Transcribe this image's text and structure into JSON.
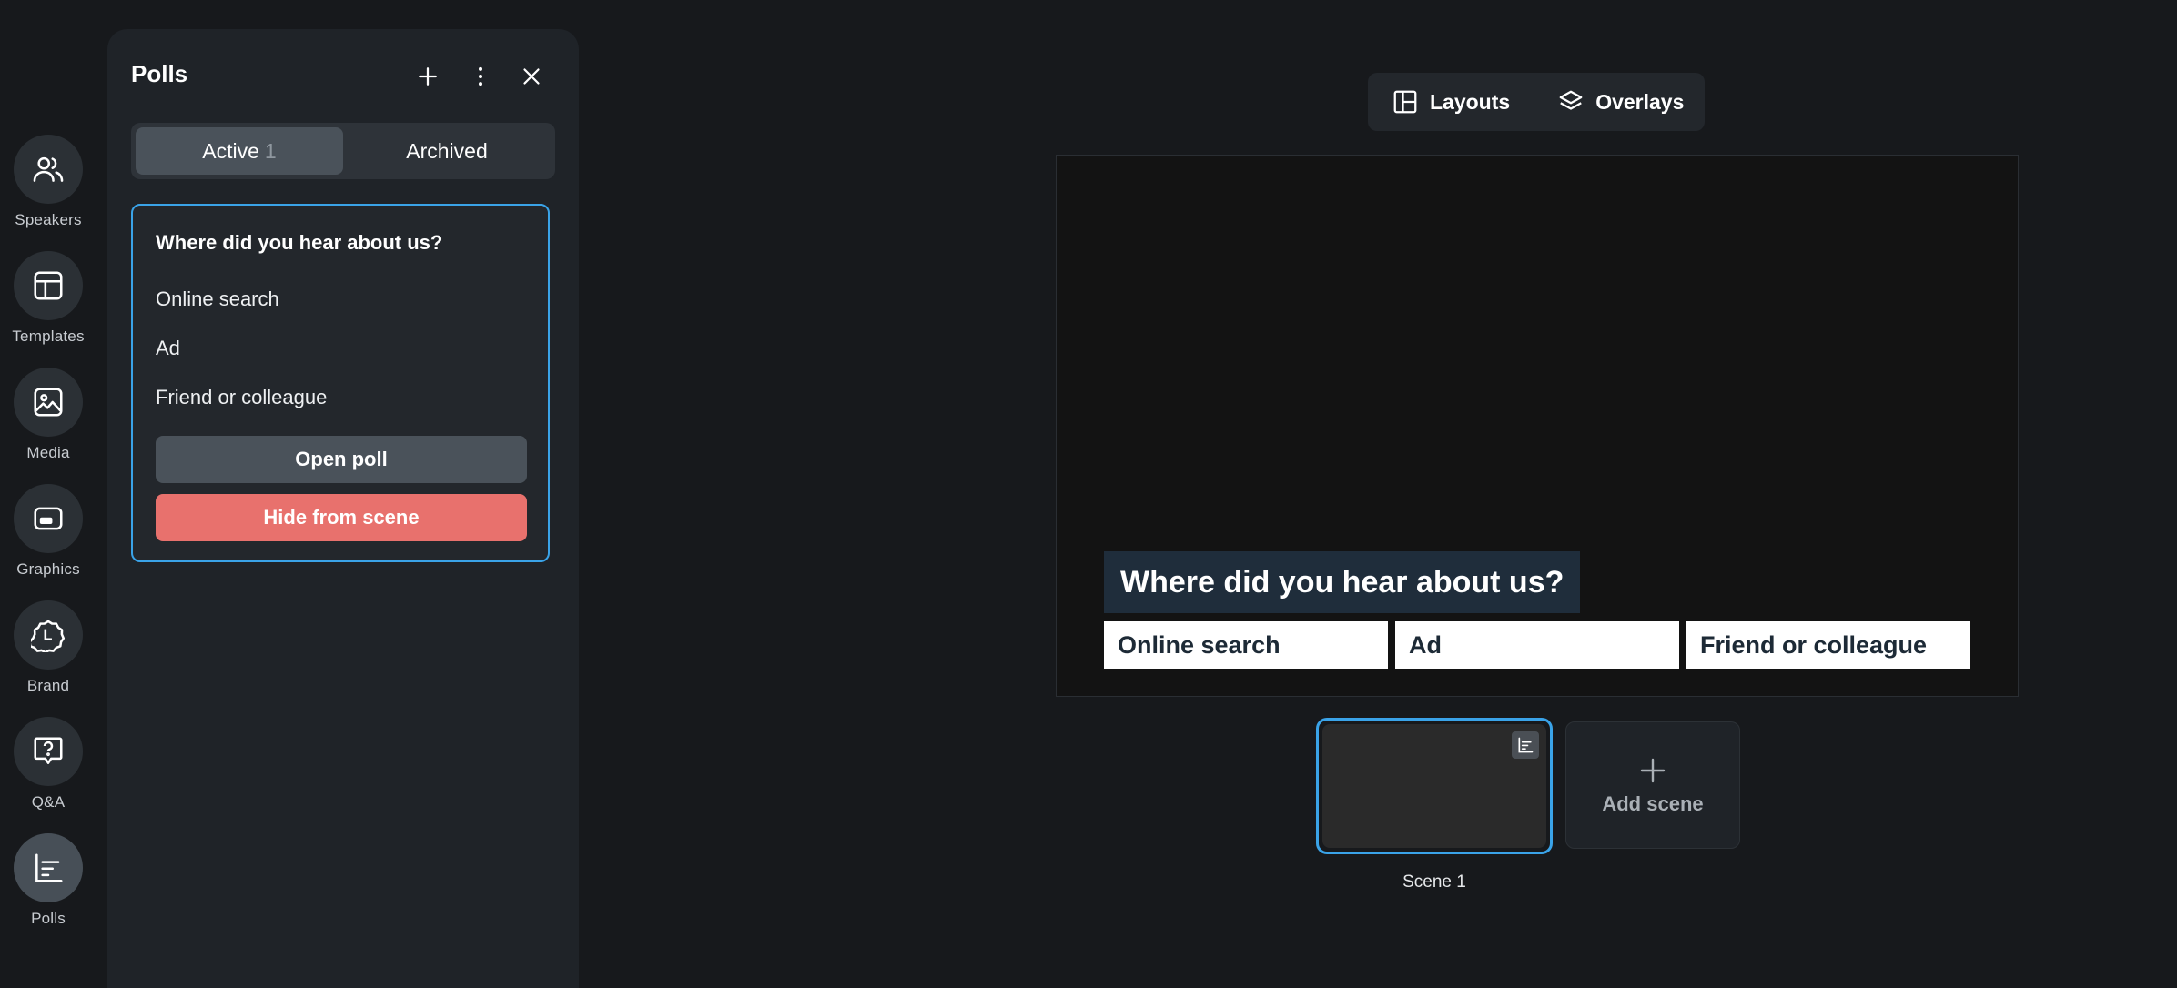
{
  "rail": {
    "items": [
      {
        "label": "Speakers",
        "icon": "speakers-icon"
      },
      {
        "label": "Templates",
        "icon": "templates-icon"
      },
      {
        "label": "Media",
        "icon": "media-icon"
      },
      {
        "label": "Graphics",
        "icon": "graphics-icon"
      },
      {
        "label": "Brand",
        "icon": "brand-icon"
      },
      {
        "label": "Q&A",
        "icon": "qa-icon"
      },
      {
        "label": "Polls",
        "icon": "polls-icon",
        "active": true
      }
    ]
  },
  "panel": {
    "title": "Polls",
    "tabs": {
      "active_label": "Active",
      "active_count": "1",
      "archived_label": "Archived"
    },
    "poll": {
      "question": "Where did you hear about us?",
      "options": [
        "Online search",
        "Ad",
        "Friend or colleague"
      ],
      "open_label": "Open poll",
      "hide_label": "Hide from scene"
    }
  },
  "toolbar": {
    "layouts_label": "Layouts",
    "overlays_label": "Overlays"
  },
  "stage": {
    "question": "Where did you hear about us?",
    "options": [
      "Online search",
      "Ad",
      "Friend or colleague"
    ]
  },
  "scenes": {
    "items": [
      {
        "label": "Scene 1"
      }
    ],
    "add_label": "Add scene"
  },
  "colors": {
    "background": "#17191c",
    "panel": "#1f2328",
    "accent": "#3aa3e8",
    "danger": "#e8716d",
    "overlay_question_bg": "#1f2d3b"
  }
}
